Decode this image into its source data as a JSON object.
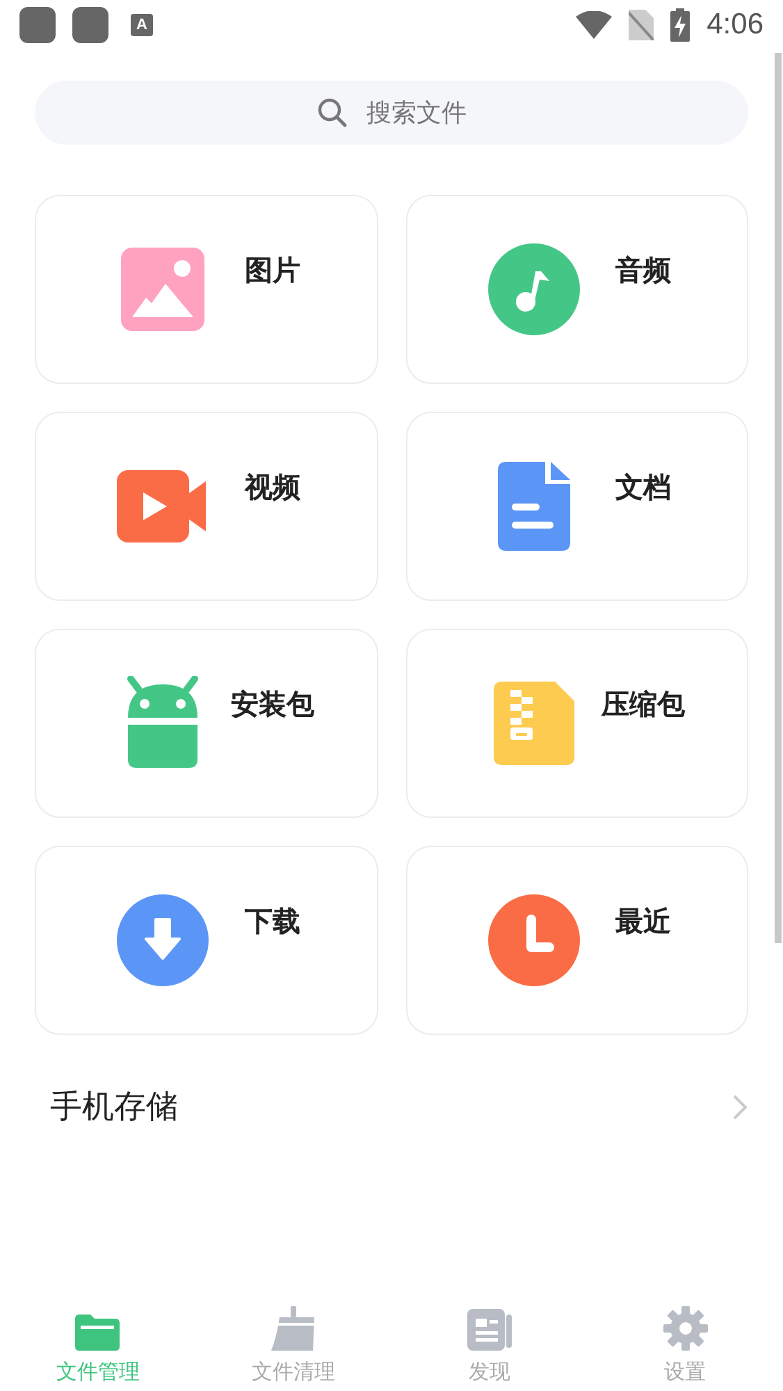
{
  "status_bar": {
    "app_badge": "A",
    "time": "4:06"
  },
  "search": {
    "placeholder": "搜索文件"
  },
  "categories": [
    {
      "kind": "image",
      "label": "图片"
    },
    {
      "kind": "audio",
      "label": "音频"
    },
    {
      "kind": "video",
      "label": "视频"
    },
    {
      "kind": "document",
      "label": "文档"
    },
    {
      "kind": "apk",
      "label": "安装包"
    },
    {
      "kind": "archive",
      "label": "压缩包"
    },
    {
      "kind": "download",
      "label": "下载"
    },
    {
      "kind": "recent",
      "label": "最近"
    }
  ],
  "storage": {
    "label": "手机存储"
  },
  "bottom_nav": [
    {
      "kind": "files",
      "label": "文件管理",
      "selected": true
    },
    {
      "kind": "clean",
      "label": "文件清理",
      "selected": false
    },
    {
      "kind": "discover",
      "label": "发现",
      "selected": false
    },
    {
      "kind": "settings",
      "label": "设置",
      "selected": false
    }
  ]
}
